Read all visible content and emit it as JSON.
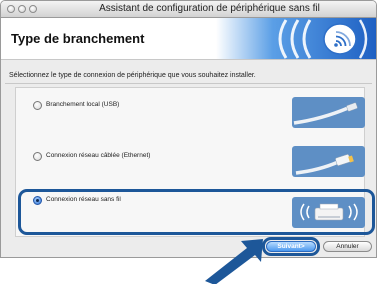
{
  "window": {
    "title": "Assistant de configuration de périphérique sans fil"
  },
  "header": {
    "title": "Type de branchement"
  },
  "instruction": "Sélectionnez le type de connexion de périphérique que vous souhaitez installer.",
  "options": [
    {
      "label": "Branchement local (USB)",
      "selected": false,
      "icon": "usb-cable-icon"
    },
    {
      "label": "Connexion réseau câblée (Ethernet)",
      "selected": false,
      "icon": "ethernet-cable-icon"
    },
    {
      "label": "Connexion réseau sans fil",
      "selected": true,
      "icon": "wireless-printer-icon"
    }
  ],
  "buttons": {
    "next": "Suivant>",
    "cancel": "Annuler"
  },
  "colors": {
    "highlight": "#1d5799",
    "primary_button": "#4b98ee"
  }
}
